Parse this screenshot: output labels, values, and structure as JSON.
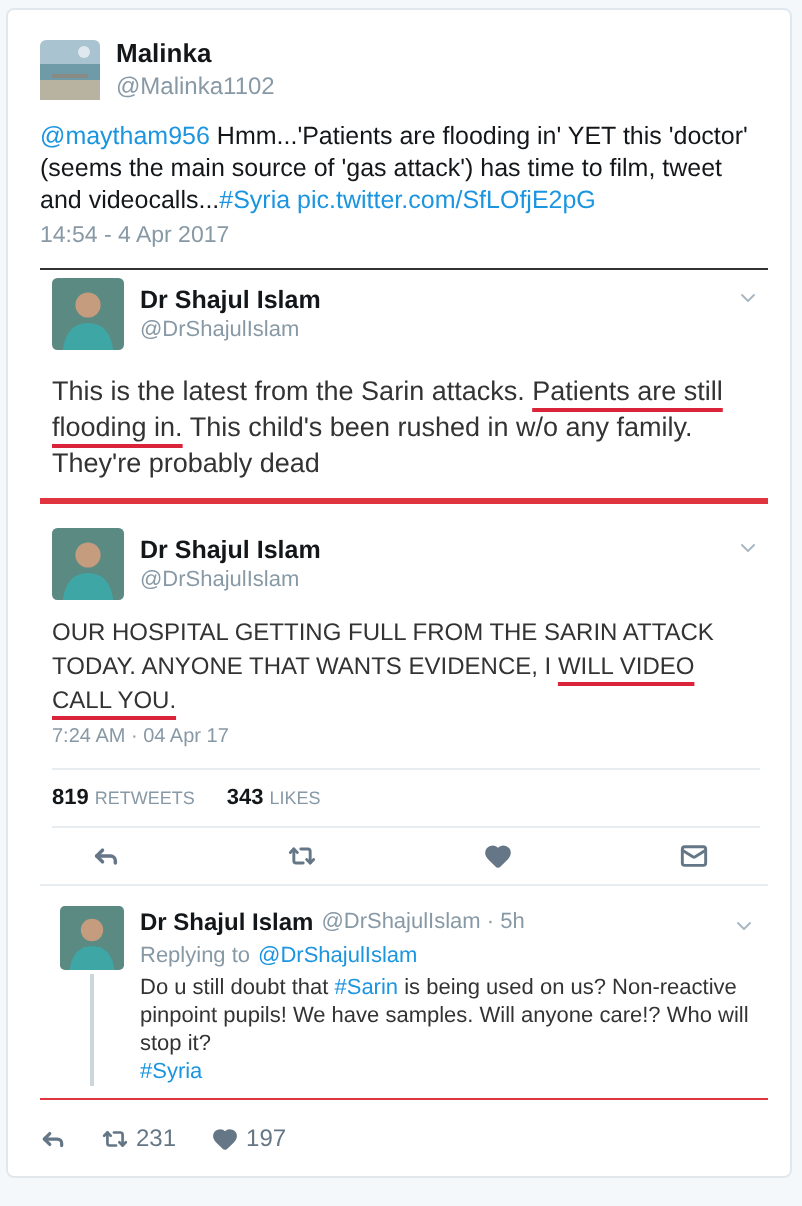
{
  "tweet": {
    "name": "Malinka",
    "handle": "@Malinka1102",
    "time": "14:54 - 4 Apr 2017",
    "body": [
      {
        "kind": "mention",
        "text": "@maytham956"
      },
      {
        "kind": "text",
        "text": " Hmm...'Patients are flooding in' YET this 'doctor' (seems the main source of 'gas attack') has time to film, tweet and videocalls..."
      },
      {
        "kind": "hashtag",
        "text": "#Syria"
      },
      {
        "kind": "url",
        "text": " pic.twitter.com/SfLOfjE2pG"
      }
    ]
  },
  "screenshot": {
    "first": {
      "name": "Dr Shajul Islam",
      "handle": "@DrShajulIslam",
      "body": [
        {
          "kind": "text",
          "text": "This is the latest from the Sarin attacks. "
        },
        {
          "kind": "marked",
          "text": "Patients are still flooding in."
        },
        {
          "kind": "text",
          "text": " This child's been rushed in w/o any family. They're probably dead"
        }
      ]
    },
    "second": {
      "name": "Dr Shajul Islam",
      "handle": "@DrShajulIslam",
      "time": "7:24 AM · 04 Apr 17",
      "body": [
        {
          "kind": "text",
          "text": "OUR HOSPITAL GETTING FULL FROM THE SARIN ATTACK TODAY. ANYONE THAT WANTS EVIDENCE, I "
        },
        {
          "kind": "marked",
          "text": "WILL VIDEO CALL YOU."
        }
      ],
      "stats": [
        {
          "count": "819",
          "label": "RETWEETS"
        },
        {
          "count": "343",
          "label": "LIKES"
        }
      ]
    },
    "reply": {
      "name": "Dr Shajul Islam",
      "handle": "@DrShajulIslam · 5h",
      "replying_label": "Replying to",
      "replying_to": "@DrShajulIslam",
      "body": [
        {
          "kind": "text",
          "text": "Do u still doubt that "
        },
        {
          "kind": "hashtag",
          "text": "#Sarin"
        },
        {
          "kind": "text",
          "text": " is being used on us? Non-reactive pinpoint pupils! We have samples. Will anyone care!? Who will stop it?"
        },
        {
          "kind": "break"
        },
        {
          "kind": "hashtag",
          "text": "#Syria"
        }
      ]
    },
    "actions": [
      {
        "kind": "reply"
      },
      {
        "kind": "retweet",
        "count": "231"
      },
      {
        "kind": "like",
        "count": "197"
      }
    ]
  }
}
